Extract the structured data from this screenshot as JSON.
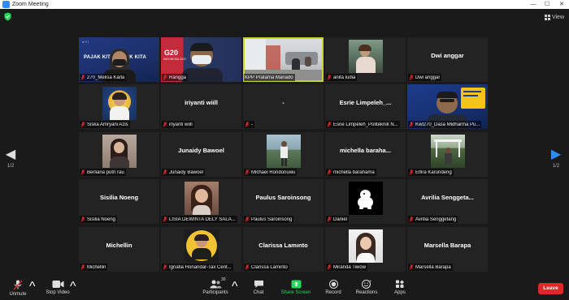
{
  "window": {
    "title": "Zoom Meeting",
    "minimize": "—",
    "maximize": "☐",
    "close": "✕"
  },
  "top": {
    "view_label": "View"
  },
  "pager": {
    "left": "1/2",
    "right": "1/2"
  },
  "tiles": [
    {
      "id": "melisa",
      "name": "270_Melisa Karla",
      "muted": true
    },
    {
      "id": "rangga",
      "name": "Rangga",
      "muted": true
    },
    {
      "id": "kpp",
      "name": "KPP Pratama Manado",
      "muted": false
    },
    {
      "id": "anita",
      "name": "anita ludia",
      "muted": true
    },
    {
      "id": "dwi",
      "name": "Dwi anggar",
      "big": "Dwi anggar",
      "muted": true
    },
    {
      "id": "siska",
      "name": "Siska Amryani Azis",
      "muted": true
    },
    {
      "id": "iriyanti",
      "name": "iriyanti wiill",
      "big": "iriyanti wiill",
      "muted": true
    },
    {
      "id": "dot",
      "name": "-",
      "big": "-",
      "muted": true
    },
    {
      "id": "esrie",
      "name": "Esrie Limpeleh_Politeknik N...",
      "big": "Esrie Limpeleh_...",
      "muted": true
    },
    {
      "id": "kwl",
      "name": "Kwl270_Dasa Midharma Pu...",
      "muted": true
    },
    {
      "id": "berliana",
      "name": "Berliana putri rau",
      "muted": true
    },
    {
      "id": "junaidy",
      "name": "Junaidy Bawoel",
      "big": "Junaidy Bawoel",
      "muted": true
    },
    {
      "id": "michael",
      "name": "Michael Rondonuwu",
      "muted": true
    },
    {
      "id": "michella",
      "name": "michella barahama",
      "big": "michella barahа...",
      "muted": true
    },
    {
      "id": "elfira",
      "name": "Elfira Karundeng",
      "muted": true
    },
    {
      "id": "sisilia",
      "name": "Sisilia Noeng",
      "big": "Sisilia Noeng",
      "muted": true
    },
    {
      "id": "lisia",
      "name": "LISIA DEWINTA DELY SALA...",
      "muted": true
    },
    {
      "id": "paulus",
      "name": "Paulus Saroinsong",
      "big": "Paulus Saroinsong",
      "muted": true
    },
    {
      "id": "daniel",
      "name": "Daniel",
      "muted": true
    },
    {
      "id": "avrilia",
      "name": "Avrilia Senggetang",
      "big": "Avrilia Senggeta...",
      "muted": true
    },
    {
      "id": "michellin",
      "name": "Michellin",
      "big": "Michellin",
      "muted": true
    },
    {
      "id": "ignatia",
      "name": "Ignatia Honandar-Tax Cent...",
      "muted": true
    },
    {
      "id": "clarissa",
      "name": "Clarissa Laminto",
      "big": "Clarissa Lamınto",
      "muted": true
    },
    {
      "id": "miranda",
      "name": "Miranda Tiwow",
      "muted": true
    },
    {
      "id": "marsella",
      "name": "Marsella Barapa",
      "big": "Marsella Barapa",
      "muted": true
    }
  ],
  "video_text": {
    "pajak": "PAJAK KITA UNTUK KITA",
    "g20": "G20",
    "g20_sub": "INDONESIA 2022"
  },
  "toolbar": {
    "unmute": "Unmute",
    "stop_video": "Stop Video",
    "participants": "Participants",
    "participants_count": "30",
    "chat": "Chat",
    "share_screen": "Share Screen",
    "record": "Record",
    "reactions": "Reactions",
    "apps": "Apps",
    "leave": "Leave",
    "caret": "^"
  },
  "colors": {
    "background": "#1a1a1a",
    "tile": "#232323",
    "active_speaker": "#c7d42a",
    "muted_mic": "#e02828",
    "share_green": "#23d959",
    "zoom_blue": "#2d8cff",
    "leave_red": "#e02828"
  }
}
